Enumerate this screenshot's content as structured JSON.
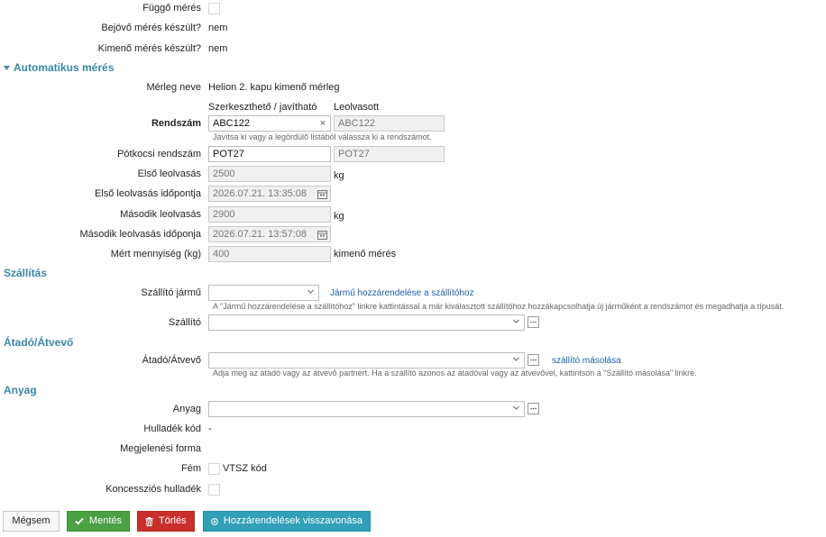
{
  "top": {
    "pending_label": "Függő mérés",
    "inbound_label": "Bejövő mérés készült?",
    "inbound_value": "nem",
    "outbound_label": "Kimenő mérés készült?",
    "outbound_value": "nem"
  },
  "auto": {
    "section_title": "Automatikus mérés",
    "scale_label": "Mérleg neve",
    "scale_value": "Helion 2. kapu kimenő mérleg",
    "col_editable": "Szerkeszthető / javítható",
    "col_read": "Leolvasott",
    "plate_label": "Rendszám",
    "plate_value": "ABC122",
    "plate_read": "ABC122",
    "plate_hint": "Javítsa ki vagy a legördülő listából válassza ki a rendszámot.",
    "trailer_label": "Pótkocsi rendszám",
    "trailer_value": "POT27",
    "trailer_read": "POT27",
    "first_read_label": "Első leolvasás",
    "first_read_value": "2500",
    "first_time_label": "Első leolvasás időpontja",
    "first_time_value": "2026.07.21. 13:35:08",
    "second_read_label": "Második leolvasás",
    "second_read_value": "2900",
    "second_time_label": "Második leolvasás időponja",
    "second_time_value": "2026.07.21. 13:57:08",
    "qty_label": "Mért mennyiség (kg)",
    "qty_value": "400",
    "qty_suffix": "kimenő mérés",
    "unit_kg": "kg"
  },
  "transport": {
    "section_title": "Szállítás",
    "vehicle_label": "Szállító jármű",
    "vehicle_link": "Jármű hozzárendelése a szállítóhoz",
    "vehicle_hint": "A \"Jármű hozzárendelése a szállítóhoz\" linkre kattintással a már kiválasztott szállítóhoz hozzákapcsolhatja új járműként a rendszámot és megadhatja a típusát.",
    "carrier_label": "Szállító"
  },
  "handover": {
    "section_title": "Átadó/Átvevő",
    "party_label": "Átadó/Átvevő",
    "copy_link": "szállító másolása",
    "hint": "Adja meg az átadó vagy az átvevő partnert. Ha a szállító azonos az átadóval vagy az átvevővel, kattintson a \"Szállító másolása\" linkre."
  },
  "material": {
    "section_title": "Anyag",
    "material_label": "Anyag",
    "waste_code_label": "Hulladék kód",
    "waste_code_value": "-",
    "display_form_label": "Megjelenési forma",
    "metal_label": "Fém",
    "vtsz_label": "VTSZ kód",
    "concession_label": "Koncessziós hulladék"
  },
  "buttons": {
    "cancel": "Mégsem",
    "save": "Mentés",
    "delete": "Törlés",
    "revoke": "Hozzárendelések visszavonása"
  },
  "colors": {
    "section": "#3a87a8",
    "save": "#4aa043",
    "delete": "#c9302c",
    "revoke": "#31a0b8",
    "link": "#1f5ea8"
  }
}
